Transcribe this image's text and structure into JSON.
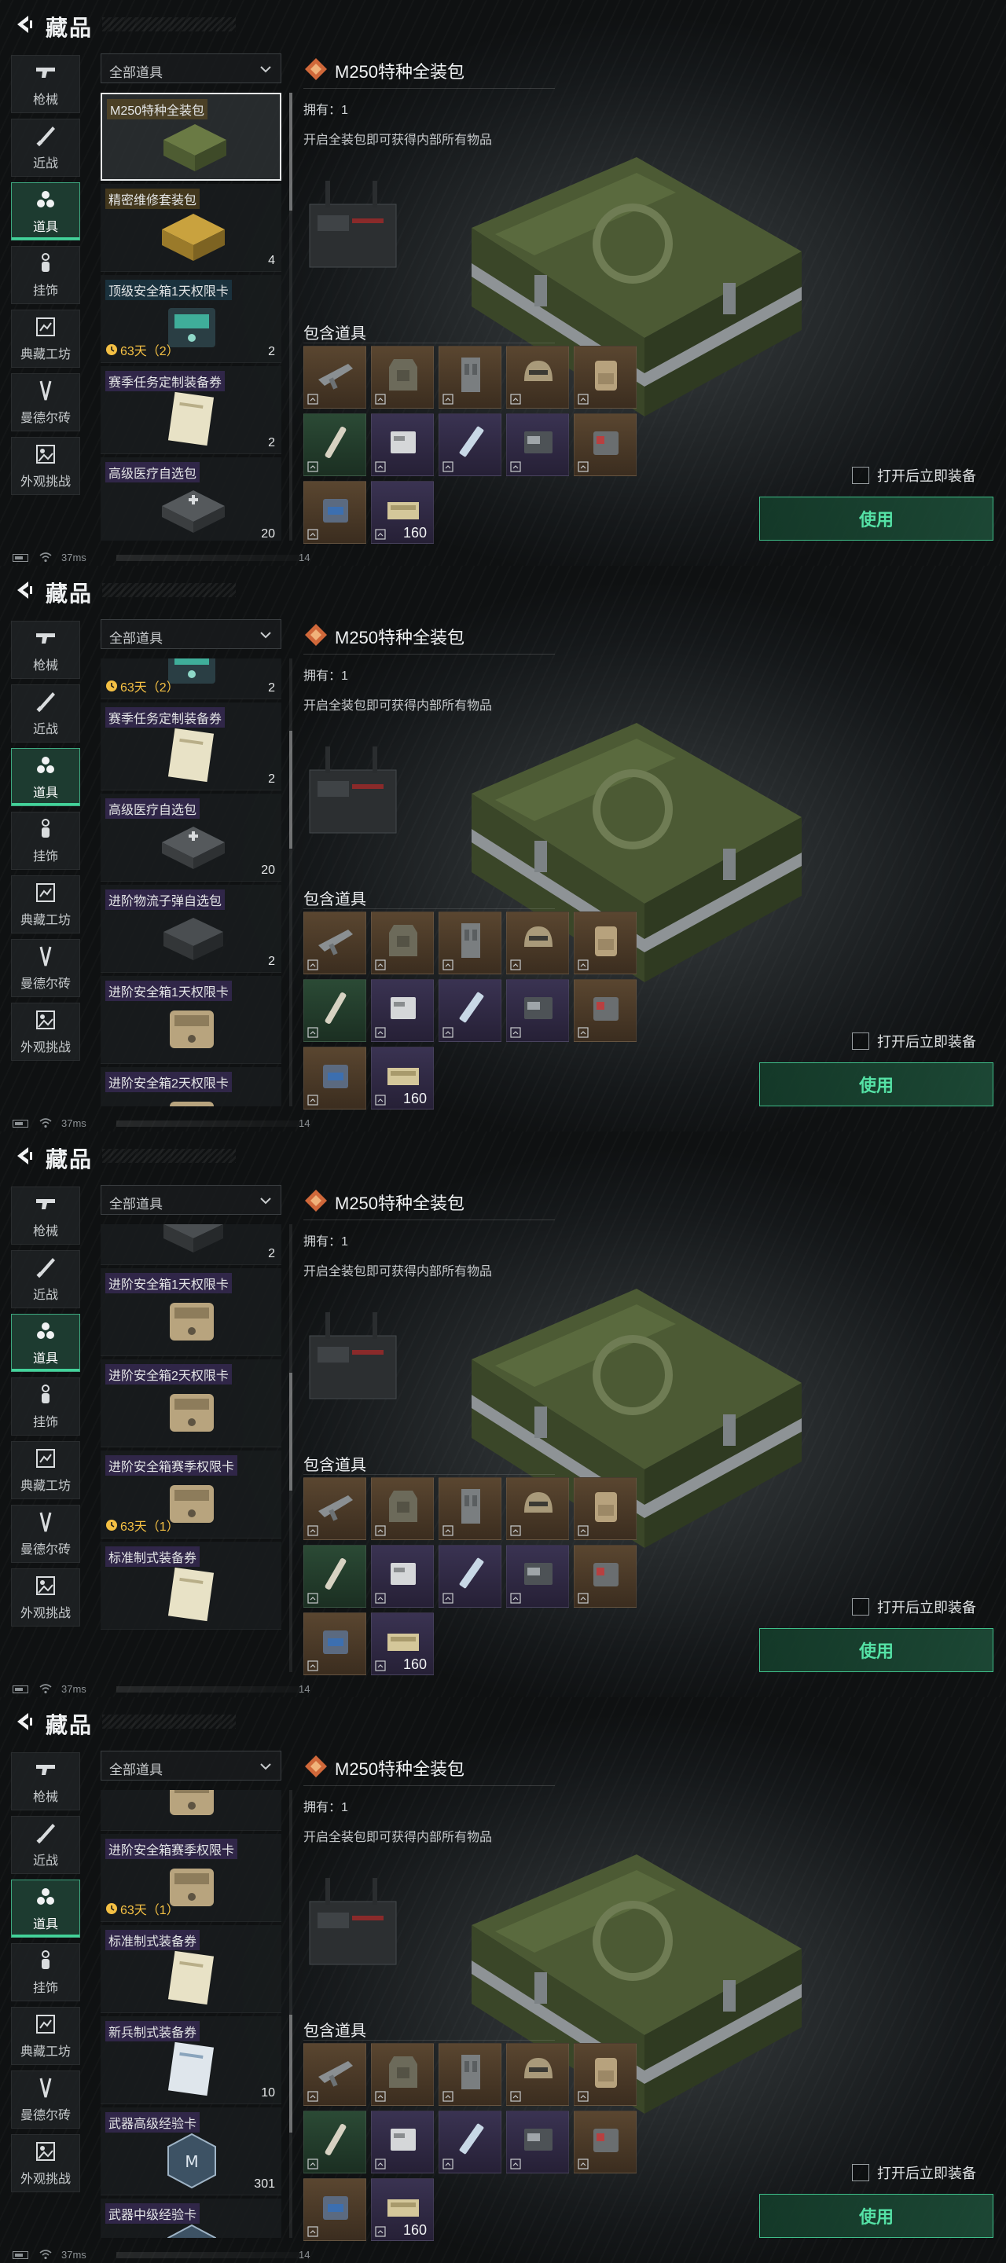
{
  "header": {
    "title": "藏品"
  },
  "sidebar": [
    {
      "label": "枪械",
      "icon": "gun-icon"
    },
    {
      "label": "近战",
      "icon": "knife-icon"
    },
    {
      "label": "道具",
      "icon": "items-icon"
    },
    {
      "label": "挂饰",
      "icon": "charm-icon"
    },
    {
      "label": "典藏工坊",
      "icon": "workshop-icon"
    },
    {
      "label": "曼德尔砖",
      "icon": "mandel-brick-icon"
    },
    {
      "label": "外观挑战",
      "icon": "appearance-icon"
    }
  ],
  "filter": {
    "label": "全部道具"
  },
  "detail": {
    "title": "M250特种全装包",
    "owned": "拥有：1",
    "description": "开启全装包即可获得内部所有物品",
    "contains_title": "包含道具",
    "tiles": [
      {
        "icon": "rifle-icon",
        "color": "brown"
      },
      {
        "icon": "armor-vest-icon",
        "color": "brown"
      },
      {
        "icon": "chest-rig-icon",
        "color": "brown"
      },
      {
        "icon": "helmet-icon",
        "color": "brown"
      },
      {
        "icon": "backpack-icon",
        "color": "brown"
      },
      {
        "icon": "injector-icon",
        "color": "green"
      },
      {
        "icon": "card-icon",
        "color": "purple"
      },
      {
        "icon": "syringe-icon",
        "color": "purple"
      },
      {
        "icon": "device-icon",
        "color": "purple"
      },
      {
        "icon": "medkit-icon",
        "color": "brown"
      },
      {
        "icon": "medical-bag-icon",
        "color": "brown"
      },
      {
        "icon": "ammo-icon",
        "color": "purple",
        "count": "160"
      }
    ],
    "equip_label": "打开后立即装备",
    "use_label": "使用"
  },
  "status": {
    "ping": "37ms",
    "page": "14"
  },
  "screens": [
    {
      "scroll": 0.0,
      "cards": [
        {
          "name": "M250特种全装包",
          "tag": "gold",
          "art": "crate-green",
          "selected": true
        },
        {
          "name": "精密维修套装包",
          "tag": "gold",
          "art": "crate-yellow",
          "count": "4"
        },
        {
          "name": "顶级安全箱1天权限卡",
          "tag": "teal",
          "art": "safe-teal",
          "time": "63天（2）",
          "count": "2"
        },
        {
          "name": "赛季任务定制装备券",
          "tag": "purple",
          "art": "ticket",
          "count": "2"
        },
        {
          "name": "高级医疗自选包",
          "tag": "purple",
          "art": "medbag",
          "count": "20"
        }
      ]
    },
    {
      "scroll": 0.22,
      "cards": [
        {
          "name": "",
          "tag": "",
          "art": "safe-teal",
          "time": "63天（2）",
          "count": "2",
          "partial": true
        },
        {
          "name": "赛季任务定制装备券",
          "tag": "purple",
          "art": "ticket",
          "count": "2"
        },
        {
          "name": "高级医疗自选包",
          "tag": "purple",
          "art": "medbag",
          "count": "20"
        },
        {
          "name": "进阶物流子弹自选包",
          "tag": "purple",
          "art": "ammobox",
          "count": "2"
        },
        {
          "name": "进阶安全箱1天权限卡",
          "tag": "purple",
          "art": "safe-tan"
        },
        {
          "name": "进阶安全箱2天权限卡",
          "tag": "purple",
          "art": "safe-tan"
        }
      ]
    },
    {
      "scroll": 0.45,
      "cards": [
        {
          "name": "进阶物流子弹自选包",
          "tag": "purple",
          "art": "ammobox",
          "count": "2",
          "partial": true
        },
        {
          "name": "进阶安全箱1天权限卡",
          "tag": "purple",
          "art": "safe-tan"
        },
        {
          "name": "进阶安全箱2天权限卡",
          "tag": "purple",
          "art": "safe-tan"
        },
        {
          "name": "进阶安全箱赛季权限卡",
          "tag": "purple",
          "art": "safe-tan",
          "time": "63天（1）"
        },
        {
          "name": "标准制式装备券",
          "tag": "purple",
          "art": "ticket"
        }
      ]
    },
    {
      "scroll": 0.68,
      "cards": [
        {
          "name": "",
          "tag": "",
          "art": "safe-tan",
          "partial": true
        },
        {
          "name": "进阶安全箱赛季权限卡",
          "tag": "purple",
          "art": "safe-tan",
          "time": "63天（1）"
        },
        {
          "name": "标准制式装备券",
          "tag": "purple",
          "art": "ticket"
        },
        {
          "name": "新兵制式装备券",
          "tag": "purple",
          "art": "ticket-blue",
          "count": "10"
        },
        {
          "name": "武器高级经验卡",
          "tag": "purple",
          "art": "exp-card",
          "count": "301"
        },
        {
          "name": "武器中级经验卡",
          "tag": "purple",
          "art": "exp-card"
        }
      ]
    }
  ]
}
